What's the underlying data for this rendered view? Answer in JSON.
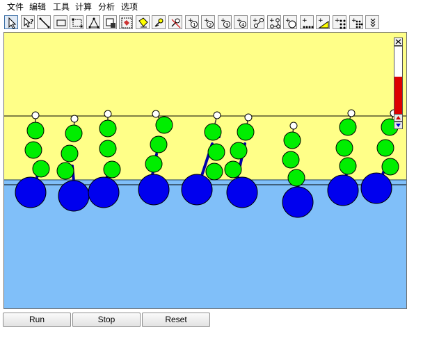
{
  "menu": {
    "file": "文件",
    "edit": "编辑",
    "tools": "工具",
    "compute": "计算",
    "analyze": "分析",
    "options": "选项"
  },
  "toolbar": {
    "tools": [
      {
        "name": "select-tool-icon",
        "selected": true
      },
      {
        "name": "help-query-tool-icon"
      },
      {
        "name": "line-tool-icon"
      },
      {
        "name": "rectangle-tool-icon"
      },
      {
        "name": "rect-select-tool-icon"
      },
      {
        "name": "triangle-tool-icon"
      },
      {
        "name": "fill-tool-icon"
      },
      {
        "name": "region-select-tool-icon"
      },
      {
        "name": "attach-tool-icon"
      },
      {
        "name": "pin-tool-icon"
      },
      {
        "name": "no-pin-tool-icon"
      },
      {
        "name": "add-charge-1-tool-icon"
      },
      {
        "name": "add-charge-2-tool-icon"
      },
      {
        "name": "add-charge-3-tool-icon"
      },
      {
        "name": "add-charge-4-tool-icon"
      },
      {
        "name": "bond-tool-icon"
      },
      {
        "name": "angle-bond-tool-icon"
      },
      {
        "name": "add-atom-tool-icon"
      },
      {
        "name": "add-chain-tool-icon"
      },
      {
        "name": "add-slope-tool-icon"
      },
      {
        "name": "add-grid-tool-icon"
      },
      {
        "name": "add-cluster-tool-icon"
      },
      {
        "name": "more-tools-icon"
      }
    ]
  },
  "colors": {
    "upper_region": "#ffff88",
    "lower_region": "#80bff9",
    "green_bead": "#00ee00",
    "blue_bead": "#0000ee",
    "bond": "#0000aa",
    "end_bead": "#ffffff",
    "scroll_fill": "#dd0000"
  },
  "scroll_level": 0.55,
  "buttons": {
    "run": "Run",
    "stop": "Stop",
    "reset": "Reset"
  }
}
